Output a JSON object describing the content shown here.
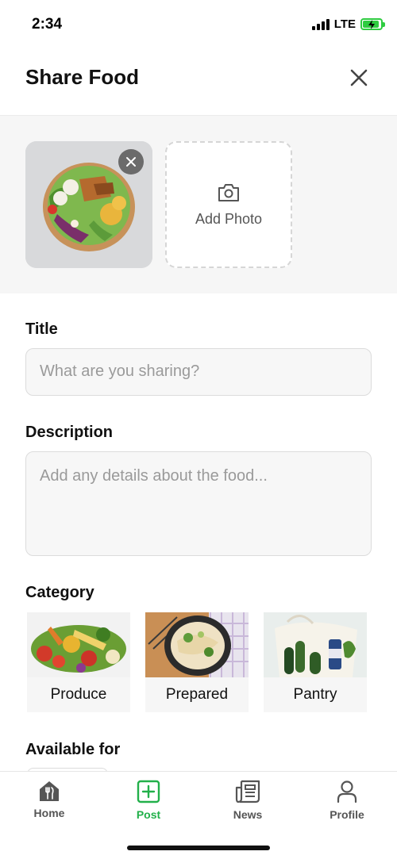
{
  "status_bar": {
    "time": "2:34",
    "network": "LTE",
    "battery_level": 0.9,
    "battery_color": "#2ecc40"
  },
  "header": {
    "title": "Share Food",
    "close_icon": "close-icon"
  },
  "photos": {
    "items": [
      {
        "description_icon": "food-bowl-photo"
      }
    ],
    "add_photo_label": "Add Photo",
    "add_photo_icon": "camera-icon"
  },
  "form": {
    "title_label": "Title",
    "title_placeholder": "What are you sharing?",
    "description_label": "Description",
    "description_placeholder": "Add any details about the food...",
    "category_label": "Category",
    "categories": [
      {
        "name": "Produce"
      },
      {
        "name": "Prepared"
      },
      {
        "name": "Pantry"
      }
    ],
    "available_label": "Available for"
  },
  "tab_bar": {
    "active_color": "#22b04a",
    "tabs": [
      {
        "label": "Home",
        "icon": "home-icon",
        "active": false
      },
      {
        "label": "Post",
        "icon": "plus-square-icon",
        "active": true
      },
      {
        "label": "News",
        "icon": "newspaper-icon",
        "active": false
      },
      {
        "label": "Profile",
        "icon": "person-icon",
        "active": false
      }
    ]
  }
}
